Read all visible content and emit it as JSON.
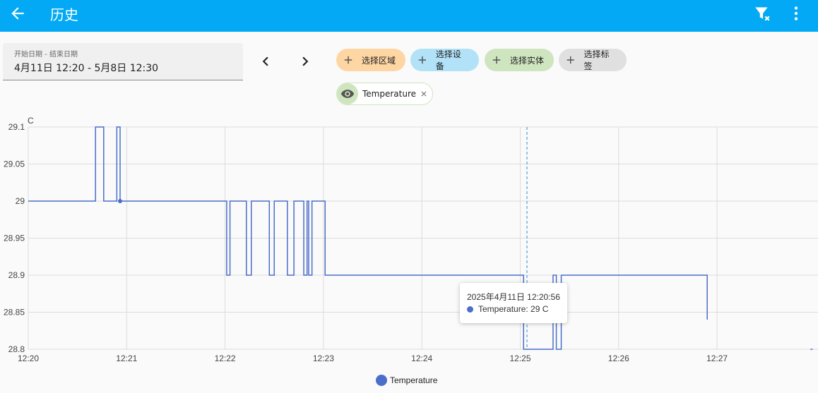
{
  "header": {
    "title": "历史",
    "back_icon": "arrow-left-icon",
    "filter_icon": "filter-remove-icon",
    "menu_icon": "dots-vertical-icon",
    "bg_color": "#03a9f4"
  },
  "date_range": {
    "label": "开始日期 - 结束日期",
    "value": "4月11日 12:20 - 5月8日 12:30"
  },
  "targets": {
    "area": "选择区域",
    "device": "选择设备",
    "entity": "选择实体",
    "label": "选择标签"
  },
  "selected_entity": {
    "name": "Temperature",
    "icon": "eye-icon"
  },
  "tooltip": {
    "time": "2025年4月11日 12:20:56",
    "value": "Temperature: 29 C"
  },
  "chart_data": {
    "type": "line",
    "step": true,
    "ylabel": "C",
    "ylim": [
      28.8,
      29.1
    ],
    "y_ticks": [
      "29.1",
      "29.05",
      "29",
      "28.95",
      "28.9",
      "28.85",
      "28.8"
    ],
    "x_ticks": [
      "12:20",
      "12:21",
      "12:22",
      "12:23",
      "12:24",
      "12:25",
      "12:26",
      "12:27"
    ],
    "grid": true,
    "legend_position": "bottom",
    "color": "#4a6ec9",
    "series": [
      {
        "name": "Temperature",
        "points": [
          [
            "12:20:00",
            29.0
          ],
          [
            "12:20:41",
            29.1
          ],
          [
            "12:20:46",
            29.0
          ],
          [
            "12:20:54",
            29.1
          ],
          [
            "12:20:56",
            29.0
          ],
          [
            "12:22:01",
            28.9
          ],
          [
            "12:22:03",
            29.0
          ],
          [
            "12:22:13",
            28.9
          ],
          [
            "12:22:16",
            29.0
          ],
          [
            "12:22:27",
            28.9
          ],
          [
            "12:22:30",
            29.0
          ],
          [
            "12:22:38",
            28.9
          ],
          [
            "12:22:42",
            29.0
          ],
          [
            "12:22:48",
            28.9
          ],
          [
            "12:22:50",
            29.0
          ],
          [
            "12:22:51",
            28.9
          ],
          [
            "12:22:53",
            29.0
          ],
          [
            "12:23:01",
            28.9
          ],
          [
            "12:25:02",
            28.8
          ],
          [
            "12:25:20",
            28.9
          ],
          [
            "12:25:22",
            28.8
          ],
          [
            "12:25:25",
            28.9
          ],
          [
            "12:26:54",
            28.84
          ]
        ],
        "last_point": [
          "12:27:57",
          28.8
        ]
      }
    ]
  }
}
